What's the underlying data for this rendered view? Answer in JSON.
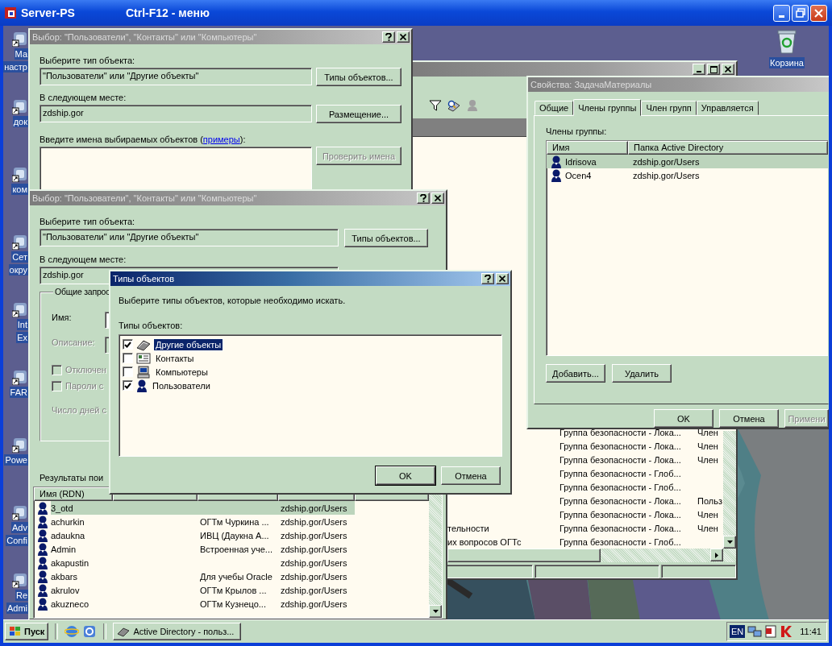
{
  "remote_window": {
    "title": "Server-PS",
    "hint": "Ctrl-F12 - меню"
  },
  "desktop_icons": [
    {
      "lines": [
        "Ма",
        "настр"
      ]
    },
    {
      "lines": [
        "док"
      ]
    },
    {
      "lines": [
        "ком"
      ]
    },
    {
      "lines": [
        "Сет",
        "окру"
      ]
    },
    {
      "lines": [
        "Int",
        "Ex"
      ]
    },
    {
      "lines": [
        "FAR"
      ]
    },
    {
      "lines": [
        "Powe"
      ]
    },
    {
      "lines": [
        "Adv",
        "Confi"
      ]
    },
    {
      "lines": [
        "Re",
        "Admi"
      ]
    }
  ],
  "recycle_bin": {
    "label": "Корзина"
  },
  "select_dialog_back": {
    "title": "Выбор: \"Пользователи\", \"Контакты\" или \"Компьютеры\"",
    "active": false,
    "type_label": "Выберите тип объекта:",
    "type_value": "\"Пользователи\" или \"Другие объекты\"",
    "type_button": "Типы объектов...",
    "location_label": "В следующем месте:",
    "location_value": "zdship.gor",
    "location_button": "Размещение...",
    "names_prompt": {
      "before": "Введите имена выбираемых объектов (",
      "link": "примеры",
      "after": "):"
    },
    "check_button": {
      "label": "Проверить имена",
      "disabled": true
    }
  },
  "console": {
    "active": false,
    "rows": [
      {
        "column_2": "Группа безопасности - Лока...",
        "column_3": "Член"
      },
      {
        "column_2": "Группа безопасности - Лока...",
        "column_3": "Член"
      },
      {
        "column_2": "Группа безопасности - Лока...",
        "column_3": "Член"
      },
      {
        "column_2": "Группа безопасности - Глоб..."
      },
      {
        "column_2": "Группа безопасности - Глоб..."
      },
      {
        "column_2": "Группа безопасности - Лока...",
        "column_3": "Польз"
      },
      {
        "column_2": "Группа безопасности - Лока...",
        "column_3": "Член"
      },
      {
        "column_1": "тельности",
        "column_2": "Группа безопасности - Лока...",
        "column_3": "Член"
      },
      {
        "column_1": "их вопросов ОГТс",
        "column_2": "Группа безопасности - Глоб..."
      }
    ]
  },
  "properties": {
    "title": "Свойства: ЗадачаМатериалы",
    "active": false,
    "tabs": [
      {
        "label": "Общие",
        "selected": false
      },
      {
        "label": "Члены группы",
        "selected": true
      },
      {
        "label": "Член групп",
        "selected": false
      },
      {
        "label": "Управляется",
        "selected": false
      }
    ],
    "members_label": "Члены группы:",
    "columns": [
      "Имя",
      "Папка Active Directory"
    ],
    "members": [
      {
        "name": "Idrisova",
        "folder": "zdship.gor/Users",
        "selected": true
      },
      {
        "name": "Ocen4",
        "folder": "zdship.gor/Users",
        "selected": false
      }
    ],
    "buttons": [
      {
        "label": "Добавить..."
      },
      {
        "label": "Удалить"
      }
    ],
    "footer_buttons": [
      {
        "label": "OK",
        "disabled": false
      },
      {
        "label": "Отмена",
        "disabled": false
      },
      {
        "label": "Примени",
        "disabled": true
      }
    ]
  },
  "select_dialog_front": {
    "title": "Выбор: \"Пользователи\", \"Контакты\" или \"Компьютеры\"",
    "active": false,
    "type_label": "Выберите тип объекта:",
    "type_value": "\"Пользователи\" или \"Другие объекты\"",
    "type_button": "Типы объектов...",
    "location_label": "В следующем месте:",
    "location_value": "zdship.gor",
    "query_group": {
      "title": "Общие запрос",
      "fields": [
        {
          "label": "Имя:",
          "disabled": false
        },
        {
          "label": "Описание:",
          "disabled": true
        }
      ],
      "checks": [
        {
          "label": "Отключен",
          "checked": false,
          "disabled": true
        },
        {
          "label": "Пароли с",
          "checked": false,
          "disabled": true
        }
      ],
      "days": {
        "label": "Число дней с",
        "disabled": true
      }
    },
    "results_label": "Результаты пои",
    "results_column_1": "Имя (RDN)",
    "results": [
      {
        "name": "3_otd",
        "folder": "zdship.gor/Users",
        "selected": true
      },
      {
        "name": "achurkin",
        "description": "ОГТм Чуркина ...",
        "folder": "zdship.gor/Users",
        "selected": false
      },
      {
        "name": "adaukna",
        "description": "ИВЦ (Даукна А...",
        "folder": "zdship.gor/Users",
        "selected": false
      },
      {
        "name": "Admin",
        "description": "Встроенная уче...",
        "folder": "zdship.gor/Users",
        "selected": false
      },
      {
        "name": "akapustin",
        "folder": "zdship.gor/Users",
        "selected": false
      },
      {
        "name": "akbars",
        "description": "Для учебы Oracle",
        "folder": "zdship.gor/Users",
        "selected": false
      },
      {
        "name": "akrulov",
        "description": "ОГТм Крылов ...",
        "folder": "zdship.gor/Users",
        "selected": false
      },
      {
        "name": "akuzneco",
        "description": "ОГТм Кузнецо...",
        "folder": "zdship.gor/Users",
        "selected": false
      }
    ]
  },
  "types_dialog": {
    "title": "Типы объектов",
    "active": true,
    "prompt": "Выберите типы объектов, которые необходимо искать.",
    "list_label": "Типы объектов:",
    "items": [
      {
        "kind": "other",
        "label": "Другие объекты",
        "checked": true,
        "selected": true
      },
      {
        "kind": "contact",
        "label": "Контакты",
        "checked": false,
        "selected": false
      },
      {
        "kind": "computer",
        "label": "Компьютеры",
        "checked": false,
        "selected": false
      },
      {
        "kind": "user",
        "label": "Пользователи",
        "checked": true,
        "selected": false
      }
    ],
    "buttons": [
      "OK",
      "Отмена"
    ]
  },
  "taskbar": {
    "start": "Пуск",
    "tasks": [
      {
        "label": "Active Directory - польз...",
        "selected": false
      }
    ],
    "language": "EN",
    "clock": "11:41"
  }
}
